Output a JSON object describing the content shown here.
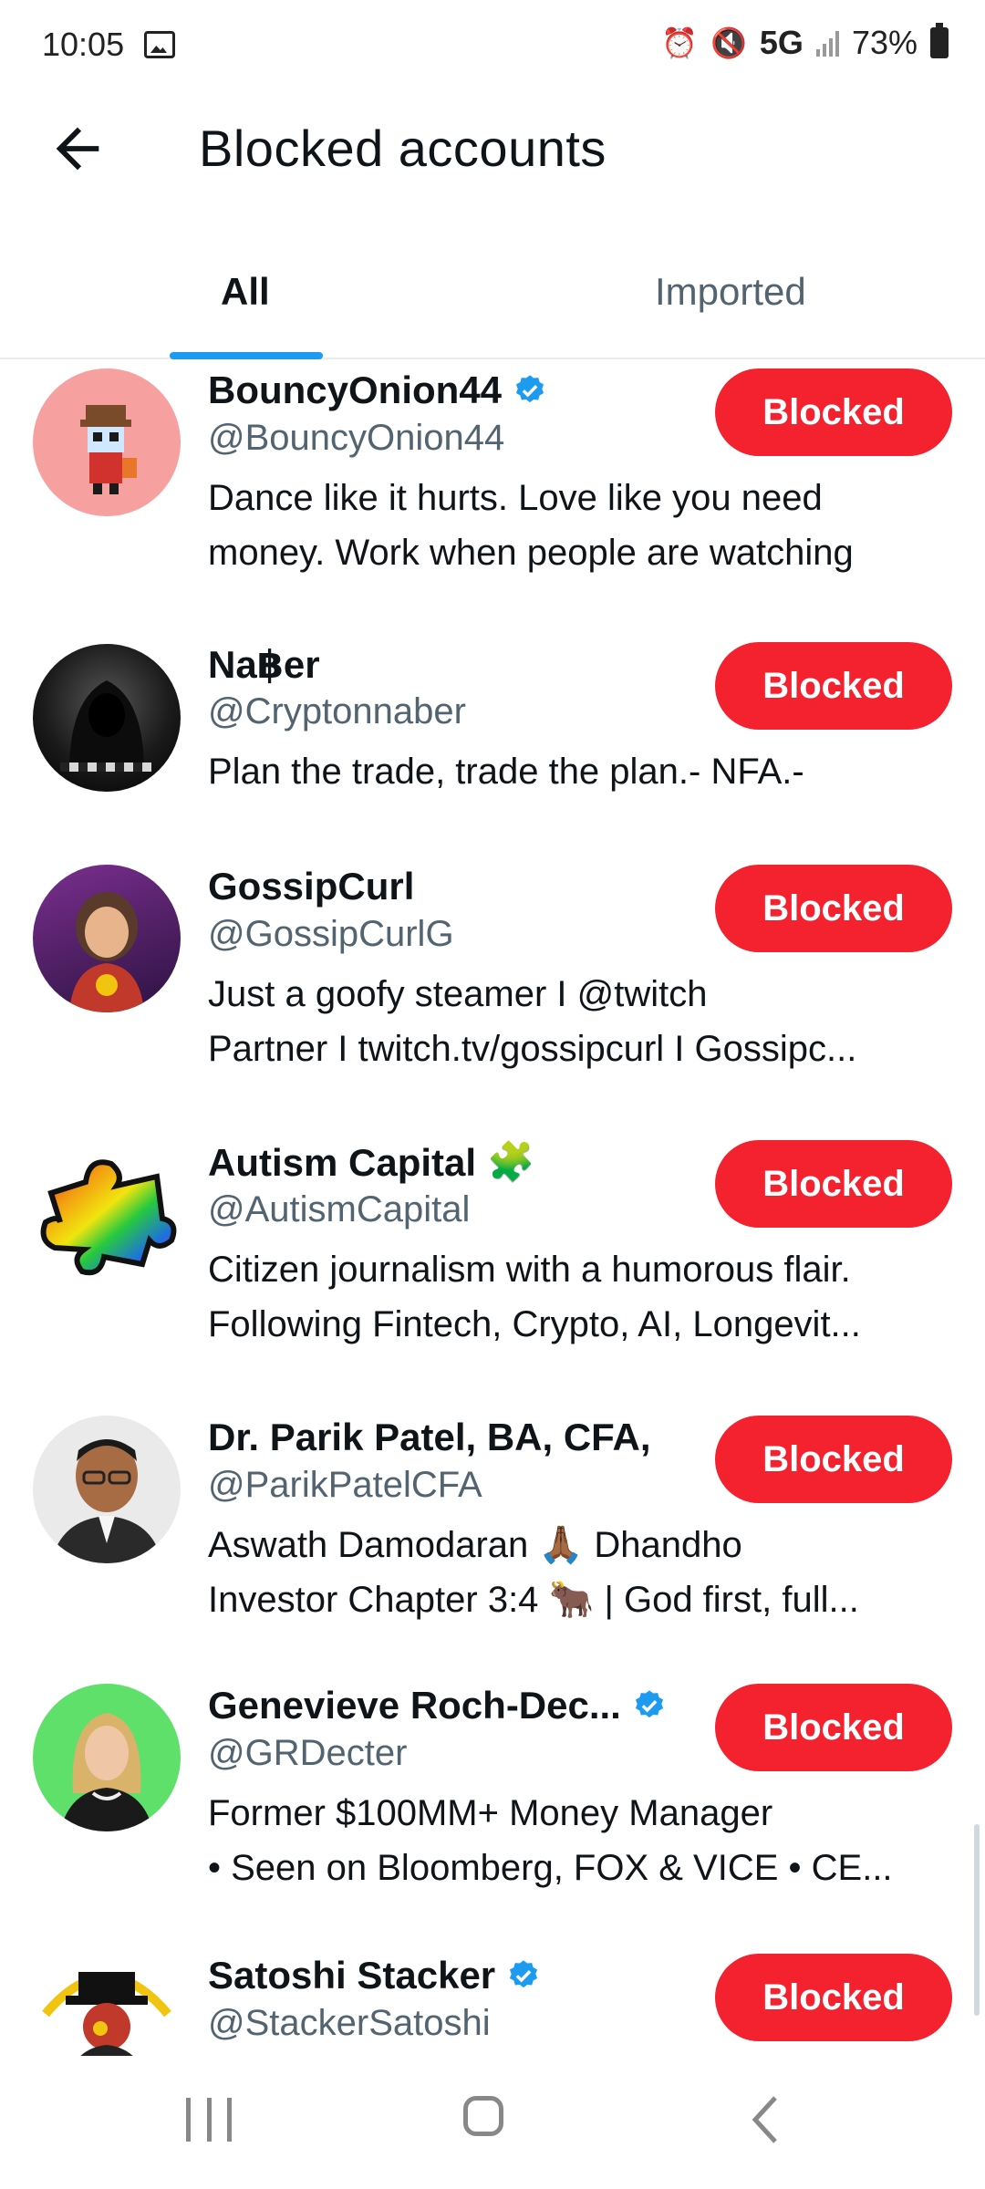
{
  "status_bar": {
    "time": "10:05",
    "network": "5G",
    "battery": "73%"
  },
  "header": {
    "title": "Blocked accounts"
  },
  "tabs": [
    {
      "label": "All"
    },
    {
      "label": "Imported"
    }
  ],
  "accounts": [
    {
      "name": "BouncyOnion44",
      "handle": "@BouncyOnion44",
      "verified": true,
      "bio": [
        "Dance like it hurts. Love like you need",
        "money. Work when people are watching"
      ],
      "button": "Blocked"
    },
    {
      "name": "Na฿er",
      "handle": "@Cryptonnaber",
      "verified": false,
      "bio": [
        "Plan the trade, trade the plan.- NFA.-"
      ],
      "button": "Blocked"
    },
    {
      "name": "GossipCurl",
      "handle": "@GossipCurlG",
      "verified": false,
      "bio": [
        "Just a goofy steamer I @twitch",
        "Partner I twitch.tv/gossipcurl I Gossipc..."
      ],
      "button": "Blocked"
    },
    {
      "name": "Autism Capital",
      "name_emoji": "🧩",
      "handle": "@AutismCapital",
      "verified": false,
      "bio": [
        "Citizen journalism with a humorous flair.",
        "Following Fintech, Crypto, AI, Longevit..."
      ],
      "button": "Blocked"
    },
    {
      "name": "Dr. Parik Patel, BA, CFA,",
      "handle": "@ParikPatelCFA",
      "verified": false,
      "bio": [
        "Aswath Damodaran 🙏🏾 Dhandho",
        "Investor Chapter 3:4 🐂 | God first, full..."
      ],
      "button": "Blocked"
    },
    {
      "name": "Genevieve Roch-Dec...",
      "handle": "@GRDecter",
      "verified": true,
      "bio": [
        "Former $100MM+ Money Manager",
        "• Seen on Bloomberg, FOX & VICE • CE..."
      ],
      "button": "Blocked"
    },
    {
      "name": "Satoshi Stacker",
      "handle": "@StackerSatoshi",
      "verified": true,
      "bio": [],
      "button": "Blocked"
    }
  ],
  "colors": {
    "accent": "#1d9bf0",
    "blocked_button": "#f4212e",
    "secondary_text": "#536471"
  }
}
